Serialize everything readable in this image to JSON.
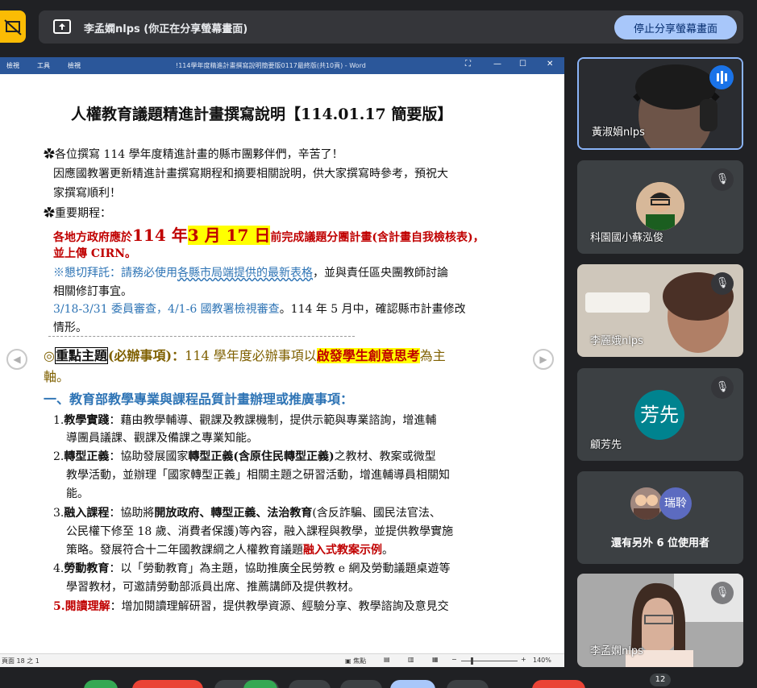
{
  "banner": {
    "text": "李孟嫻nlps (你正在分享螢幕畫面)",
    "stop_label": "停止分享螢幕畫面"
  },
  "word": {
    "menu": [
      "檢視",
      "工具",
      "檢視"
    ],
    "title": "!114學年度精進計畫撰寫說明簡要版0117最終版(共10頁) - Word",
    "status_left": "頁面 18 之 1",
    "focus": "焦點",
    "zoom": "140%"
  },
  "doc": {
    "title": "人權教育議題精進計畫撰寫說明【114.01.17 簡要版】",
    "p1": "各位撰寫 114 學年度精進計畫的縣市團夥伴們，辛苦了！",
    "p2": "因應國教署更新精進計畫撰寫期程和摘要相關說明，供大家撰寫時參考，預祝大",
    "p3": "家撰寫順利！",
    "p4": "重要期程：",
    "p5a": "各地方政府應於",
    "p5b": "114 年",
    "p5c": "3 月 17 日",
    "p5d": "前完成議題分團計畫(含計畫自我檢核表)，",
    "p6": "並上傳 CIRN。",
    "p7a": "※懇切拜託：請務必使用",
    "p7b": "各縣市局端提供的最新表格",
    "p7c": "，並與責任區央團教師討論",
    "p8": "相關修訂事宜。",
    "p9a": "3/18-3/31 委員審查，4/1-6 國教署檢視審查",
    "p9b": "。114 年 5 月中，確認縣市計畫修改",
    "p10": "情形。",
    "p11a": "◎",
    "p11b": "重點主題",
    "p11c": "(必辦事項)：",
    "p11d": "114 學年度必辦事項以",
    "p11e": "啟發學生創意思考",
    "p11f": "為主",
    "p12": "軸。",
    "h1": "一、教育部教學專業與課程品質計畫辦理或推廣事項：",
    "i1a": "1.",
    "i1b": "教學實踐",
    "i1c": "：藉由教學輔導、觀課及教課機制，提供示範與專業諮詢，增進輔",
    "i1d": "導團員議課、觀課及備課之專業知能。",
    "i2a": "2.",
    "i2b": "轉型正義",
    "i2c": "：協助發展國家",
    "i2d": "轉型正義(含原住民轉型正義)",
    "i2e": "之教材、教案或微型",
    "i2f": "教學活動，並辦理「國家轉型正義」相關主題之研習活動，增進輔導員相關知",
    "i2g": "能。",
    "i3a": "3.",
    "i3b": "融入課程",
    "i3c": "：協助將",
    "i3d": "開放政府、轉型正義、法治教育",
    "i3e": "(含反詐騙、國民法官法、",
    "i3f": "公民權下修至 18 歲、消費者保護)等內容，融入課程與教學，並提供教學實施",
    "i3g": "策略。發展符合十二年國教課綱之人權教育議題",
    "i3h": "融入式教案示例",
    "i3i": "。",
    "i4a": "4.",
    "i4b": "勞動教育",
    "i4c": "：以「勞動教育」為主題，協助推廣全民勞教 e 網及勞動議題桌遊等",
    "i4d": "學習教材，可邀請勞動部派員出席、推薦講師及提供教材。",
    "i5a": "5.",
    "i5b": "閱讀理解",
    "i5c": "：增加閱讀理解研習，提供教學資源、經驗分享、教學諮詢及意見交"
  },
  "participants": [
    {
      "name": "黃淑娟nlps"
    },
    {
      "name": "科園國小蘇泓俊"
    },
    {
      "name": "李麗娥nlps"
    },
    {
      "name": "顧芳先",
      "initials": "芳先"
    },
    {
      "name": "還有另外 6 位使用者",
      "initials": "瑞聆"
    },
    {
      "name": "李孟嫻nlps"
    }
  ],
  "people_count": "12",
  "colors": {
    "accent": "#a8c7fa",
    "avatar_teal": "#00838f",
    "avatar_blue": "#5c6bc0",
    "presenting": "#fbbc04"
  }
}
